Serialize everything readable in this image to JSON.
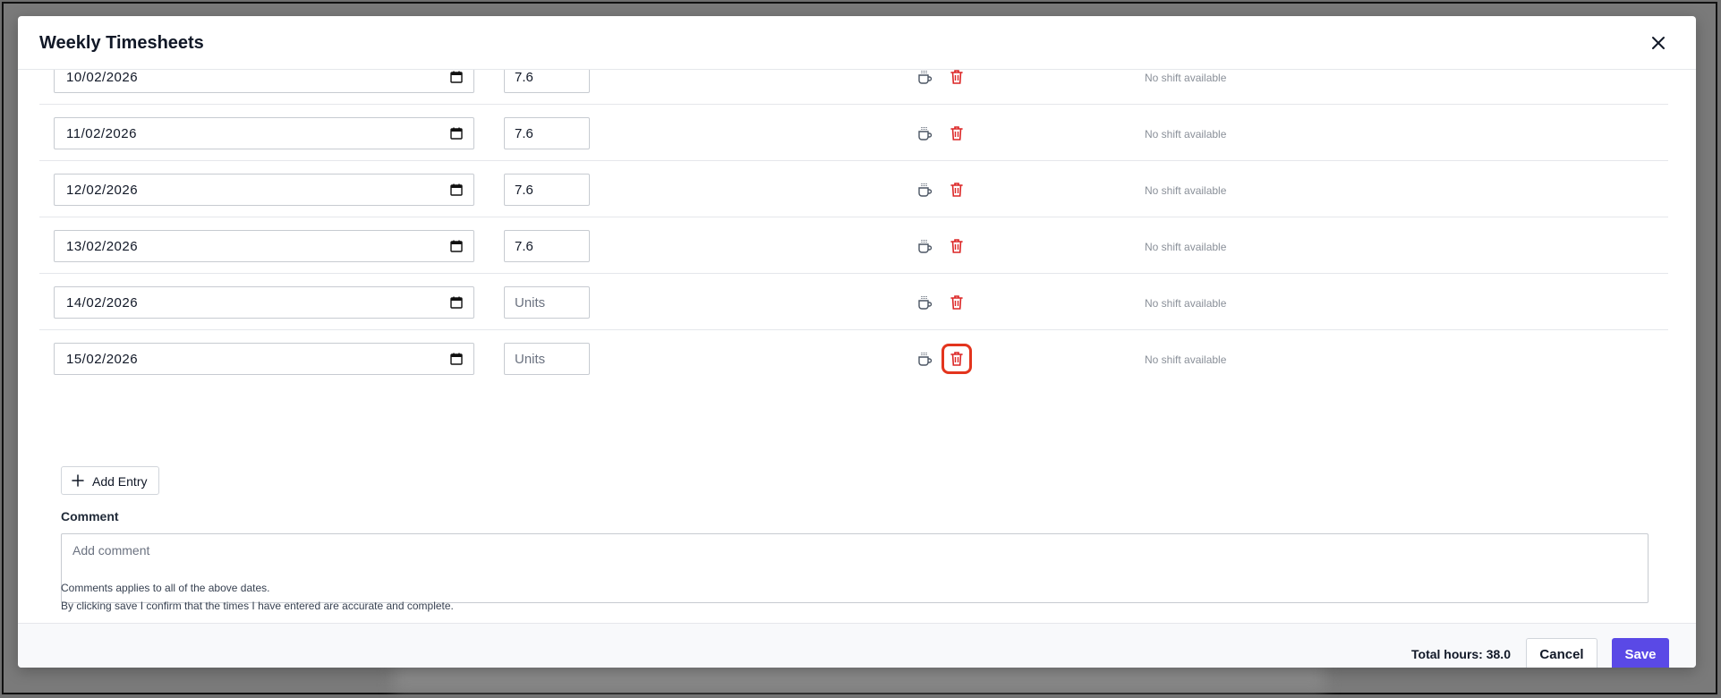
{
  "dialog": {
    "title": "Weekly Timesheets"
  },
  "entries": [
    {
      "date": "10/02/2026",
      "units_value": "7.6",
      "units_placeholder": "Units",
      "shift_text": "No shift available"
    },
    {
      "date": "11/02/2026",
      "units_value": "7.6",
      "units_placeholder": "Units",
      "shift_text": "No shift available"
    },
    {
      "date": "12/02/2026",
      "units_value": "7.6",
      "units_placeholder": "Units",
      "shift_text": "No shift available"
    },
    {
      "date": "13/02/2026",
      "units_value": "7.6",
      "units_placeholder": "Units",
      "shift_text": "No shift available"
    },
    {
      "date": "14/02/2026",
      "units_value": "",
      "units_placeholder": "Units",
      "shift_text": "No shift available"
    },
    {
      "date": "15/02/2026",
      "units_value": "",
      "units_placeholder": "Units",
      "shift_text": "No shift available",
      "trash_highlighted": true
    }
  ],
  "add_entry": {
    "label": "Add Entry"
  },
  "comment": {
    "label": "Comment",
    "placeholder": "Add comment",
    "value": ""
  },
  "notes": {
    "line1": "Comments applies to all of the above dates.",
    "line2": "By clicking save I confirm that the times I have entered are accurate and complete."
  },
  "footer": {
    "total_hours": "Total hours: 38.0",
    "cancel_label": "Cancel",
    "save_label": "Save"
  },
  "colors": {
    "accent": "#5a49e6",
    "danger": "#dc2626",
    "highlight": "#e3341d"
  },
  "icons": {
    "close": "close-icon",
    "calendar": "calendar-icon",
    "break": "coffee-cup-icon",
    "delete": "trash-icon",
    "add": "plus-icon"
  }
}
